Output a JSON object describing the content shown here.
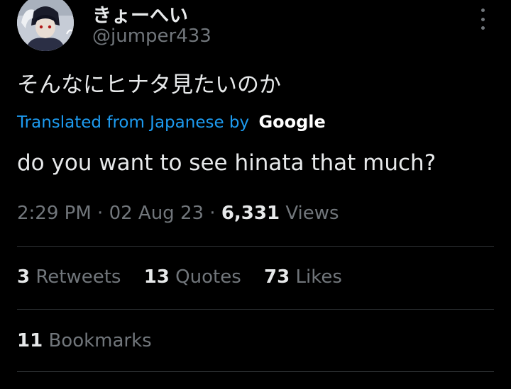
{
  "user": {
    "display_name": "きょーへい",
    "handle": "@jumper433"
  },
  "tweet": {
    "text": "そんなにヒナタ見たいのか",
    "translated_label": "Translated from Japanese by",
    "translator": "Google",
    "translation": "do you want to see hinata that much?"
  },
  "meta": {
    "time": "2:29 PM",
    "separator": "·",
    "date": "02 Aug 23",
    "views_count": "6,331",
    "views_label": "Views"
  },
  "stats": {
    "retweets_count": "3",
    "retweets_label": "Retweets",
    "quotes_count": "13",
    "quotes_label": "Quotes",
    "likes_count": "73",
    "likes_label": "Likes",
    "bookmarks_count": "11",
    "bookmarks_label": "Bookmarks"
  },
  "icons": {
    "more": "more-vertical-icon"
  },
  "colors": {
    "background": "#000000",
    "text": "#e7e9ea",
    "secondary": "#71767b",
    "link": "#1d9bf0",
    "divider": "#2f3336"
  }
}
